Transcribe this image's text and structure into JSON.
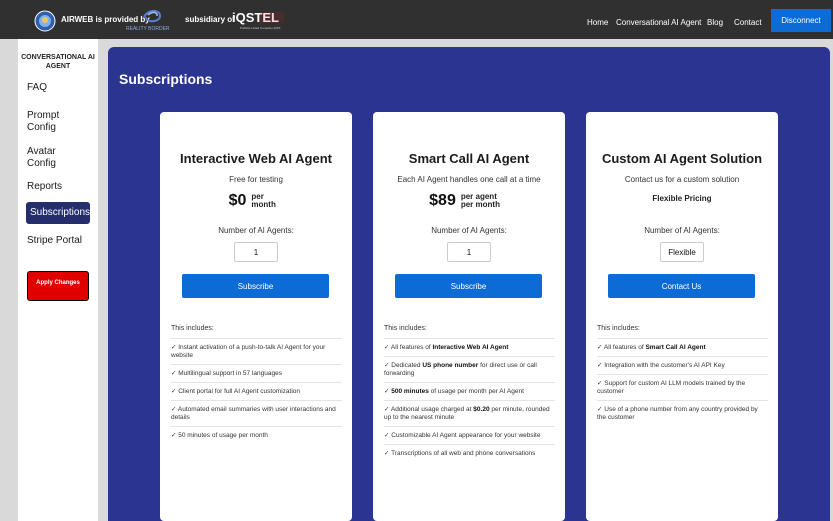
{
  "topbar": {
    "brand_text": "AIRWEB is provided by",
    "partner_logo_text": "REALITY BORDER",
    "subsidiary_text": "subsidiary of",
    "iqs_logo_text": "iQSTEL",
    "iqs_logo_tagline": "Publicly Listed Company IQST",
    "nav": [
      "Home",
      "Conversational AI Agent",
      "Blog",
      "Contact"
    ],
    "disconnect_label": "Disconnect"
  },
  "sidebar": {
    "heading": "CONVERSATIONAL AI AGENT",
    "items": [
      {
        "label": "FAQ"
      },
      {
        "label": "Prompt Config"
      },
      {
        "label": "Avatar Config"
      },
      {
        "label": "Reports"
      },
      {
        "label": "Subscriptions",
        "active": true
      },
      {
        "label": "Stripe Portal"
      }
    ],
    "apply_label": "Apply Changes"
  },
  "main": {
    "title": "Subscriptions",
    "cards": [
      {
        "title": "Interactive Web AI Agent",
        "subtitle": "Free for testing",
        "price": "$0",
        "price_unit": "per month",
        "agents_label": "Number of AI Agents:",
        "qty": "1",
        "button": "Subscribe",
        "includes": "This includes:",
        "features": [
          "✓ Instant activation of a push-to-talk AI Agent for your website",
          "✓ Multilingual support in 57 languages",
          "✓ Client portal for full AI Agent customization",
          "✓ Automated email summaries with user interactions and details",
          "✓ 50 minutes of usage per month"
        ]
      },
      {
        "title": "Smart Call AI Agent",
        "subtitle": "Each AI Agent handles one call at a time",
        "price": "$89",
        "price_unit": "per agent per month",
        "agents_label": "Number of AI Agents:",
        "qty": "1",
        "button": "Subscribe",
        "includes": "This includes:",
        "features": [
          "✓ All features of <b>Interactive Web AI Agent</b>",
          "✓ Dedicated <b>US phone number</b> for direct use or call forwarding",
          "✓ <b>500 minutes</b> of usage per month per AI Agent",
          "✓ Additional usage charged at <b>$0.20</b> per minute, rounded up to the nearest minute",
          "✓ Customizable AI Agent appearance for your website",
          "✓ Transcriptions of all web and phone conversations"
        ]
      },
      {
        "title": "Custom AI Agent Solution",
        "subtitle": "Contact us for a custom solution",
        "price_flex": "Flexible Pricing",
        "agents_label": "Number of AI Agents:",
        "qty": "Flexible",
        "button": "Contact Us",
        "includes": "This includes:",
        "features": [
          "✓ All features of <b>Smart Call AI Agent</b>",
          "✓ Integration with the customer's AI API Key",
          "✓ Support for custom AI LLM models trained by the customer",
          "✓ Use of a phone number from any country provided by the customer"
        ]
      }
    ]
  }
}
